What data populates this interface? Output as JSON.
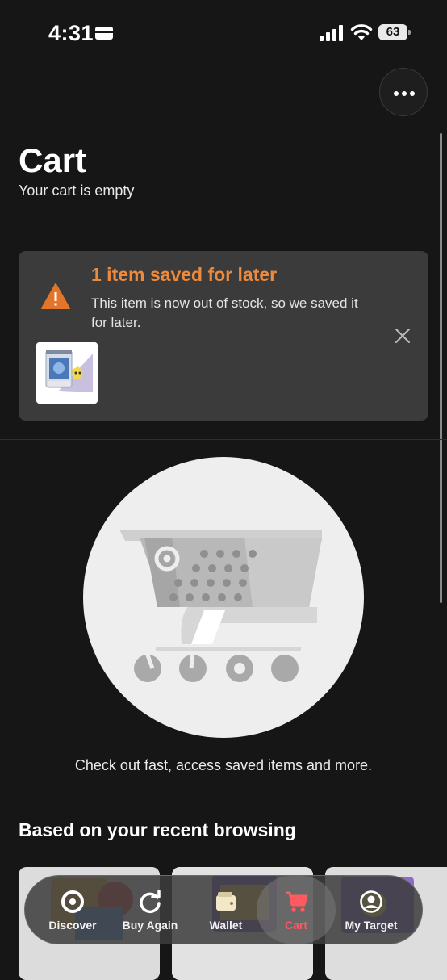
{
  "status_bar": {
    "time": "4:31",
    "battery": "63"
  },
  "header": {
    "title": "Cart",
    "subtitle": "Your cart is empty"
  },
  "saved_notice": {
    "title": "1 item saved for later",
    "message": "This item is now out of stock, so we saved it for later."
  },
  "empty_cart": {
    "hint": "Check out fast, access saved items and more."
  },
  "recent": {
    "heading": "Based on your recent browsing"
  },
  "nav": {
    "items": [
      {
        "label": "Discover",
        "icon": "target-icon"
      },
      {
        "label": "Buy Again",
        "icon": "refresh-icon"
      },
      {
        "label": "Wallet",
        "icon": "wallet-icon"
      },
      {
        "label": "Cart",
        "icon": "cart-icon"
      },
      {
        "label": "My Target",
        "icon": "person-icon"
      }
    ],
    "active": "Cart"
  },
  "colors": {
    "background": "#161616",
    "card": "#3b3b3b",
    "warning_orange": "#ee8a3c",
    "active_nav": "#ff5a5f"
  }
}
